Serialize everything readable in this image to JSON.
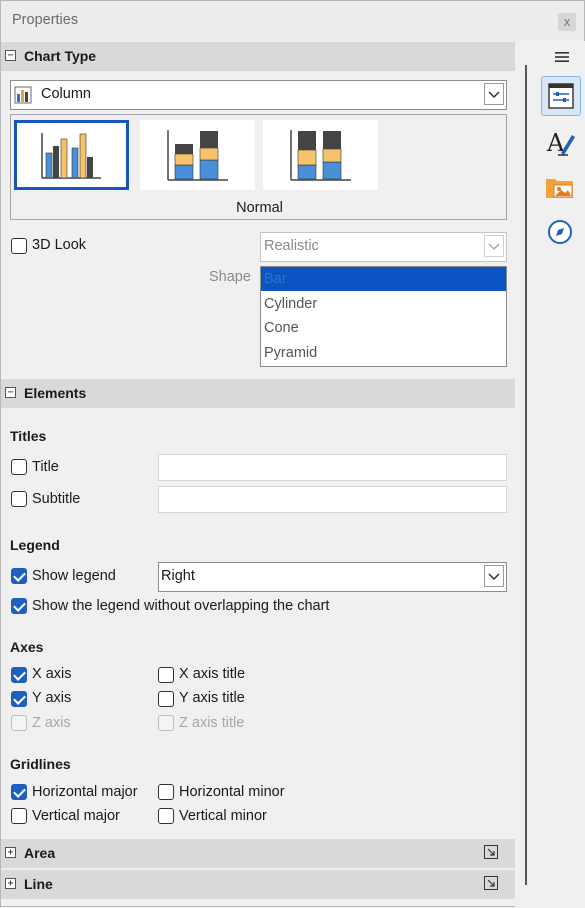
{
  "window": {
    "title": "Properties",
    "close_label": "x"
  },
  "chart_type": {
    "header": "Chart Type",
    "type_value": "Column",
    "variant_caption": "Normal",
    "look_3d_label": "3D Look",
    "look_3d_checked": false,
    "look_value": "Realistic",
    "shape_label": "Shape",
    "shape_options": [
      "Bar",
      "Cylinder",
      "Cone",
      "Pyramid"
    ],
    "shape_selected": "Bar"
  },
  "elements": {
    "header": "Elements",
    "titles_group": "Titles",
    "title_label": "Title",
    "subtitle_label": "Subtitle",
    "title_value": "",
    "subtitle_value": "",
    "legend_group": "Legend",
    "show_legend_label": "Show legend",
    "legend_position": "Right",
    "no_overlap_label": "Show the legend without overlapping the chart",
    "axes_group": "Axes",
    "x_axis_label": "X axis",
    "y_axis_label": "Y axis",
    "z_axis_label": "Z axis",
    "x_axis_title_label": "X axis title",
    "y_axis_title_label": "Y axis title",
    "z_axis_title_label": "Z axis title",
    "gridlines_group": "Gridlines",
    "h_major_label": "Horizontal major",
    "h_minor_label": "Horizontal minor",
    "v_major_label": "Vertical major",
    "v_minor_label": "Vertical minor"
  },
  "area": {
    "header": "Area"
  },
  "line": {
    "header": "Line"
  },
  "colors": {
    "accent": "#1f5fbf",
    "selection": "#0a55c2",
    "header_bg": "#d9d9d9"
  },
  "icons": {
    "deck_menu": "hamburger-icon",
    "deck_properties": "properties-icon",
    "deck_styles": "styles-icon",
    "deck_gallery": "gallery-icon",
    "deck_navigator": "navigator-icon"
  }
}
